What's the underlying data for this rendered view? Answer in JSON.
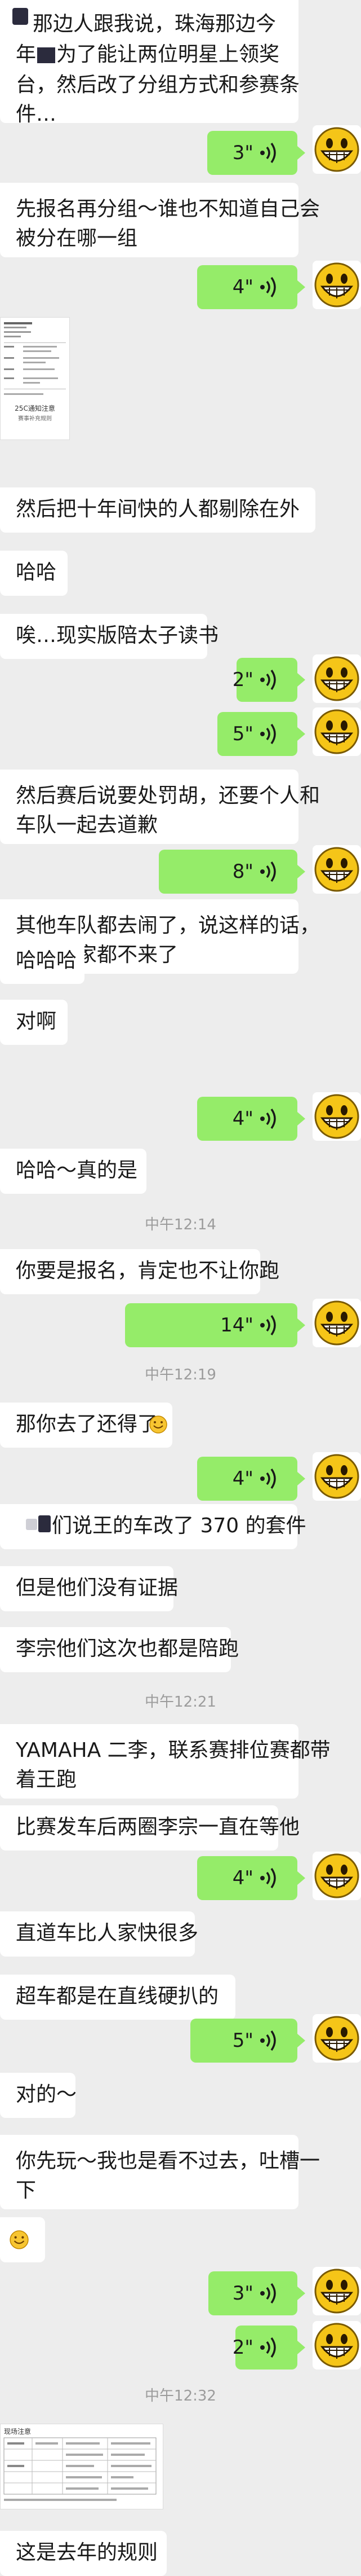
{
  "messages": {
    "m1_line1": "那边人跟我说，珠海那边今",
    "m1_line2": "年",
    "m1_line2b": "为了能让两位明星上领奖",
    "m1_line3": "台，然后改了分组方式和参赛条",
    "m1_line4": "件…",
    "v1": "3\"",
    "m2_line1": "先报名再分组～谁也不知道自己会",
    "m2_line2": "被分在哪一组",
    "v2": "4\"",
    "doc1_title": "25C通知注意",
    "doc1_sub": "赛事补充规则",
    "m3": "然后把十年间快的人都剔除在外",
    "m4": "哈哈",
    "m5": "唉…现实版陪太子读书",
    "v3": "2\"",
    "v4": "5\"",
    "m6_line1": "然后赛后说要处罚胡，还要个人和",
    "m6_line2": "车队一起去道歉",
    "v5": "8\"",
    "m7_line1": "其他车队都去闹了，说这样的话，",
    "m7_line2": "明年大家都不来了",
    "m8": "哈哈哈",
    "m9": "对啊",
    "v6": "4\"",
    "m10": "哈哈～真的是",
    "ts1": "中午12:14",
    "m11": "你要是报名，肯定也不让你跑",
    "v7": "14\"",
    "ts2": "中午12:19",
    "m12": "那你去了还得了",
    "v8": "4\"",
    "m13": "们说王的车改了 370 的套件",
    "m14": "但是他们没有证据",
    "m15": "李宗他们这次也都是陪跑",
    "ts3": "中午12:21",
    "m16_line1": "YAMAHA 二李，联系赛排位赛都带",
    "m16_line2": "着王跑",
    "m17": "比赛发车后两圈李宗一直在等他",
    "v9": "4\"",
    "m18": "直道车比人家快很多",
    "m19": "超车都是在直线硬扒的",
    "v10": "5\"",
    "m20": "对的～",
    "m21_line1": "你先玩～我也是看不过去，吐槽一",
    "m21_line2": "下",
    "v11": "3\"",
    "v12": "2\"",
    "ts4": "中午12:32",
    "doc2_title": "现场注意",
    "m22": "这是去年的规则"
  },
  "colors": {
    "background": "#ededed",
    "incoming": "#ffffff",
    "outgoing": "#95ec69",
    "timestamp": "#9c9c9c"
  },
  "icons": {
    "voice": "voice-wave-icon",
    "avatar": "smiley-avatar-icon",
    "sticker": "smile-emoji-icon"
  }
}
